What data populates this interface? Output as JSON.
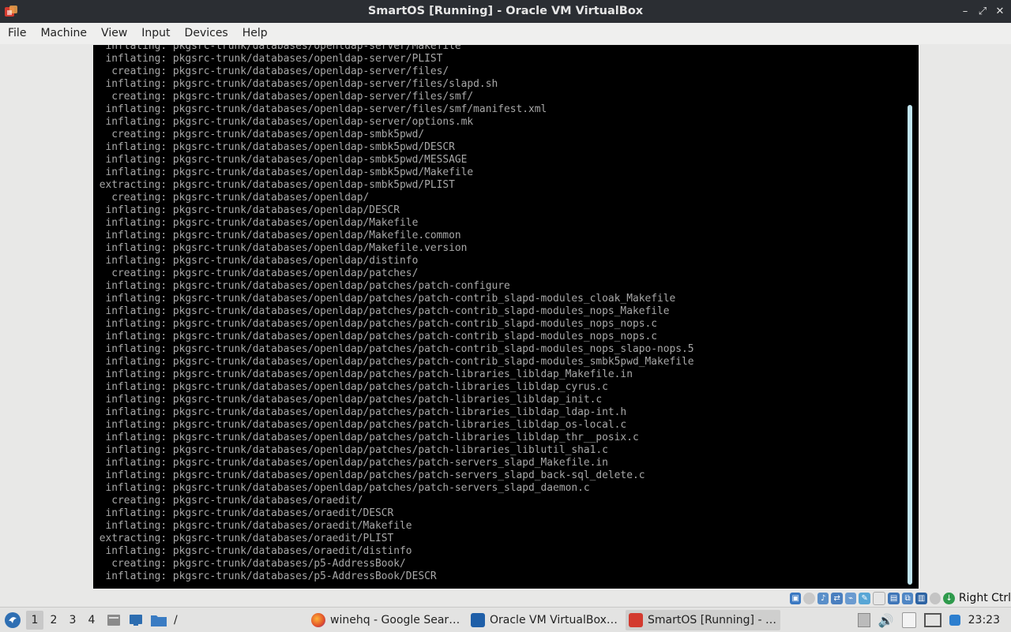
{
  "window": {
    "title": "SmartOS [Running] - Oracle VM VirtualBox",
    "minimize_glyph": "–",
    "maximize_glyph": "⤢",
    "close_glyph": "✕"
  },
  "menu": [
    "File",
    "Machine",
    "View",
    "Input",
    "Devices",
    "Help"
  ],
  "console_lines": [
    "  inflating: pkgsrc-trunk/databases/openldap-server/Makefile",
    "  inflating: pkgsrc-trunk/databases/openldap-server/PLIST",
    "   creating: pkgsrc-trunk/databases/openldap-server/files/",
    "  inflating: pkgsrc-trunk/databases/openldap-server/files/slapd.sh",
    "   creating: pkgsrc-trunk/databases/openldap-server/files/smf/",
    "  inflating: pkgsrc-trunk/databases/openldap-server/files/smf/manifest.xml",
    "  inflating: pkgsrc-trunk/databases/openldap-server/options.mk",
    "   creating: pkgsrc-trunk/databases/openldap-smbk5pwd/",
    "  inflating: pkgsrc-trunk/databases/openldap-smbk5pwd/DESCR",
    "  inflating: pkgsrc-trunk/databases/openldap-smbk5pwd/MESSAGE",
    "  inflating: pkgsrc-trunk/databases/openldap-smbk5pwd/Makefile",
    " extracting: pkgsrc-trunk/databases/openldap-smbk5pwd/PLIST",
    "   creating: pkgsrc-trunk/databases/openldap/",
    "  inflating: pkgsrc-trunk/databases/openldap/DESCR",
    "  inflating: pkgsrc-trunk/databases/openldap/Makefile",
    "  inflating: pkgsrc-trunk/databases/openldap/Makefile.common",
    "  inflating: pkgsrc-trunk/databases/openldap/Makefile.version",
    "  inflating: pkgsrc-trunk/databases/openldap/distinfo",
    "   creating: pkgsrc-trunk/databases/openldap/patches/",
    "  inflating: pkgsrc-trunk/databases/openldap/patches/patch-configure",
    "  inflating: pkgsrc-trunk/databases/openldap/patches/patch-contrib_slapd-modules_cloak_Makefile",
    "  inflating: pkgsrc-trunk/databases/openldap/patches/patch-contrib_slapd-modules_nops_Makefile",
    "  inflating: pkgsrc-trunk/databases/openldap/patches/patch-contrib_slapd-modules_nops_nops.c",
    "  inflating: pkgsrc-trunk/databases/openldap/patches/patch-contrib_slapd-modules_nops_nops.c",
    "  inflating: pkgsrc-trunk/databases/openldap/patches/patch-contrib_slapd-modules_nops_slapo-nops.5",
    "  inflating: pkgsrc-trunk/databases/openldap/patches/patch-contrib_slapd-modules_smbk5pwd_Makefile",
    "  inflating: pkgsrc-trunk/databases/openldap/patches/patch-libraries_libldap_Makefile.in",
    "  inflating: pkgsrc-trunk/databases/openldap/patches/patch-libraries_libldap_cyrus.c",
    "  inflating: pkgsrc-trunk/databases/openldap/patches/patch-libraries_libldap_init.c",
    "  inflating: pkgsrc-trunk/databases/openldap/patches/patch-libraries_libldap_ldap-int.h",
    "  inflating: pkgsrc-trunk/databases/openldap/patches/patch-libraries_libldap_os-local.c",
    "  inflating: pkgsrc-trunk/databases/openldap/patches/patch-libraries_libldap_thr__posix.c",
    "  inflating: pkgsrc-trunk/databases/openldap/patches/patch-libraries_liblutil_sha1.c",
    "  inflating: pkgsrc-trunk/databases/openldap/patches/patch-servers_slapd_Makefile.in",
    "  inflating: pkgsrc-trunk/databases/openldap/patches/patch-servers_slapd_back-sql_delete.c",
    "  inflating: pkgsrc-trunk/databases/openldap/patches/patch-servers_slapd_daemon.c",
    "   creating: pkgsrc-trunk/databases/oraedit/",
    "  inflating: pkgsrc-trunk/databases/oraedit/DESCR",
    "  inflating: pkgsrc-trunk/databases/oraedit/Makefile",
    " extracting: pkgsrc-trunk/databases/oraedit/PLIST",
    "  inflating: pkgsrc-trunk/databases/oraedit/distinfo",
    "   creating: pkgsrc-trunk/databases/p5-AddressBook/",
    "  inflating: pkgsrc-trunk/databases/p5-AddressBook/DESCR"
  ],
  "vm_status": {
    "host_key": "Right Ctrl"
  },
  "taskbar": {
    "workspaces": [
      "1",
      "2",
      "3",
      "4"
    ],
    "path_label": "/",
    "tasks": [
      {
        "label": "winehq - Google Sear…",
        "icon": "firefox-icon"
      },
      {
        "label": "Oracle VM VirtualBox…",
        "icon": "virtualbox-icon"
      },
      {
        "label": "SmartOS [Running] - …",
        "icon": "virtualbox-vm-icon"
      }
    ],
    "clock": "23:23"
  },
  "colors": {
    "titlebar": "#2b2e33",
    "console_bg": "#000000",
    "console_text": "#a8a8a8",
    "scrollbar": "#bfe3ee"
  }
}
